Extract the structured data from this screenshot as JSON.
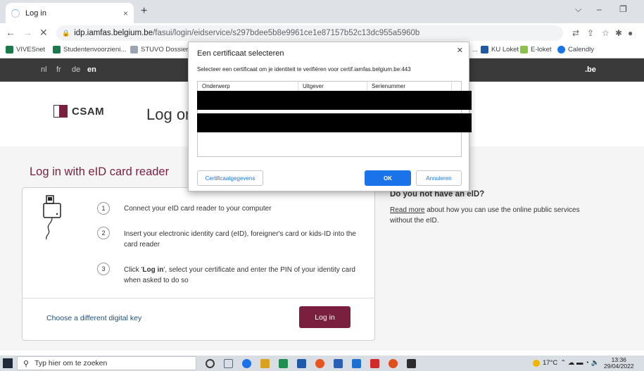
{
  "browser": {
    "tab_title": "Log in",
    "tab_close": "×",
    "new_tab": "+",
    "window_controls": {
      "chevron": "⌵",
      "minimize": "–",
      "restore": "❐"
    },
    "nav": {
      "back": "←",
      "forward": "→",
      "stop": "✕"
    },
    "url_host": "idp.iamfas.belgium.be",
    "url_path": "/fasui/login/eidservice/s297bdee5b8e9961ce1e87157b52c13dc955a5960b",
    "bookmarks": [
      {
        "label": "VIVESnet",
        "color": "#1a7a4a"
      },
      {
        "label": "Studentenvoorzieni...",
        "color": "#1a7a4a"
      },
      {
        "label": "STUVO Dossiers",
        "color": "#9aa6b2"
      },
      {
        "label": "KU Loket",
        "color": "#1f5aa6"
      },
      {
        "label": "E-loket",
        "color": "#8bc34a"
      },
      {
        "label": "Calendly",
        "color": "#1a73e8"
      }
    ],
    "bookmarks_overflow": "..."
  },
  "site": {
    "languages": [
      "nl",
      "fr",
      "de",
      "en"
    ],
    "active_language": "en",
    "be_logo": ".be",
    "logo_text": "CSAM",
    "page_title": "Log on",
    "section_title": "Log in with eID card reader",
    "steps": [
      {
        "num": "1",
        "text": "Connect your eID card reader to your computer"
      },
      {
        "num": "2",
        "text": "Insert your electronic identity card (eID), foreigner's card or kids-ID into the card reader"
      },
      {
        "num": "3",
        "bold": "Log in",
        "pre": "Click '",
        "post": "', select your certificate and enter the PIN of your identity card when asked to do so"
      }
    ],
    "alt_key_link": "Choose a different digital key",
    "login_button": "Log in",
    "no_eid_title": "Do you not have an eID?",
    "no_eid_link": "Read more",
    "no_eid_text": " about how you can use the online public services without the eID."
  },
  "dialog": {
    "title": "Een certificaat selecteren",
    "close": "✕",
    "description": "Selecteer een certificaat om je identiteit te verifiëren voor certif.iamfas.belgium.be:443",
    "columns": [
      "Onderwerp",
      "Uitgever",
      "Serienummer"
    ],
    "details_button": "Certificaatgegevens",
    "ok_button": "OK",
    "cancel_button": "Annuleren"
  },
  "taskbar": {
    "search_placeholder": "Typ hier om te zoeken",
    "weather": "17°C",
    "time": "13:36",
    "date": "29/04/2022",
    "app_colors": [
      "#3a3a3a",
      "#5a6a7a",
      "#1a73e8",
      "#d9a21e",
      "#1f8f4f",
      "#1e5aa8",
      "#e8541e",
      "#2b5fb5",
      "#1e6fd1",
      "#d02a2a",
      "#e04e1b",
      "#2c2c2c"
    ]
  }
}
